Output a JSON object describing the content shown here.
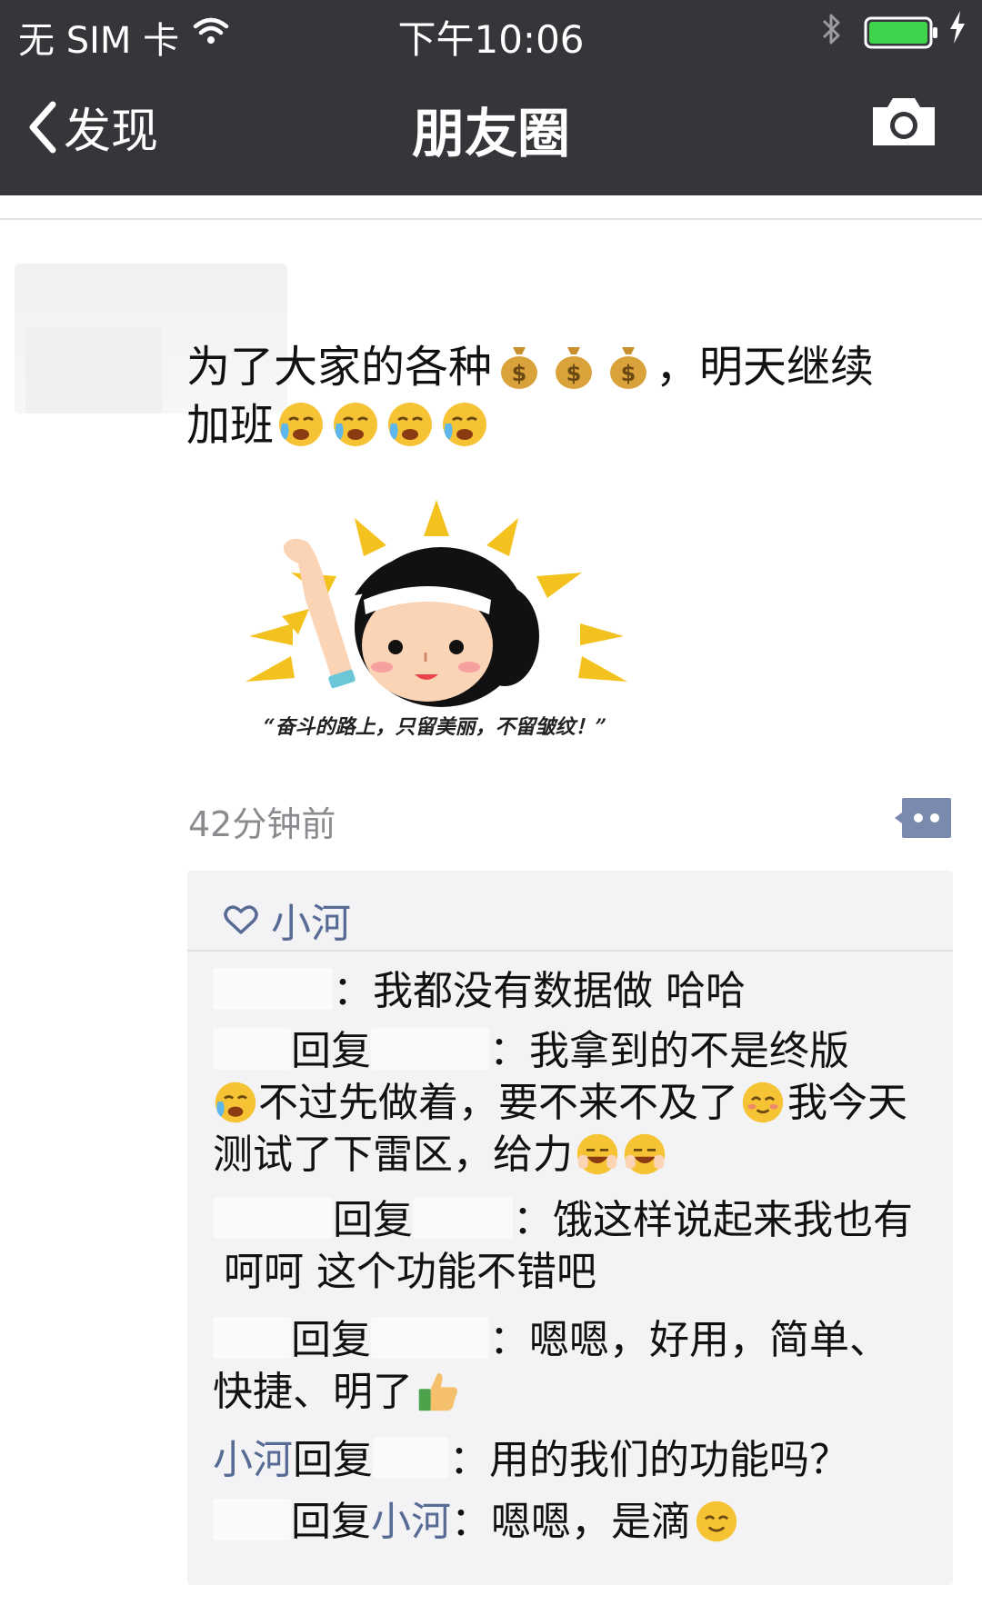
{
  "status_bar": {
    "carrier": "无 SIM 卡",
    "time": "下午10:06",
    "battery_color": "#3ed34a"
  },
  "nav": {
    "back_label": "发现",
    "title": "朋友圈"
  },
  "post": {
    "text_part1": "为了大家的各种",
    "text_part2": "，明天继续",
    "text_part3": "加班",
    "image_caption": "“奋斗的路上，只留美丽，不留皱纹！”",
    "time_ago": "42分钟前"
  },
  "likes": {
    "names": "小河"
  },
  "comments": [
    {
      "text": "：我都没有数据做 哈哈"
    },
    {
      "reply_word": "回复",
      "text": "：我拿到的不是终版",
      "text2": "不过先做着，要不来不及了",
      "text3": "我今天测试了下雷区，给力"
    },
    {
      "reply_word": "回复",
      "text": "：饿这样说起来我也有",
      "text2": "呵呵 这个功能不错吧"
    },
    {
      "reply_word": "回复",
      "text": "：嗯嗯，好用，简单、",
      "text2": "快捷、明了"
    },
    {
      "author": "小河",
      "reply_word": "回复",
      "text": "：用的我们的功能吗？"
    },
    {
      "reply_word": "回复",
      "target": "小河",
      "text": "：嗯嗯，是滴"
    }
  ],
  "colors": {
    "nav_bg": "#35353a",
    "link_blue": "#576b95",
    "comment_bg": "#f3f3f5"
  },
  "icons": {
    "back": "chevron-left-icon",
    "camera": "camera-icon",
    "wifi": "wifi-icon",
    "bluetooth": "bluetooth-icon",
    "like": "heart-icon",
    "comment": "comment-dots-icon"
  }
}
